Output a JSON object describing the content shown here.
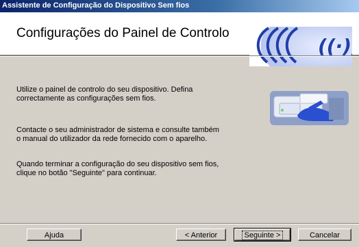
{
  "window": {
    "title": "Assistente de Configuração do Dispositivo Sem fios"
  },
  "header": {
    "title": "Configurações do Painel de Controlo",
    "logo_icon": "wireless-logo-icon"
  },
  "content": {
    "paragraphs": [
      [
        "Utilize o painel de controlo do seu dispositivo. Defina",
        "correctamente as configurações sem fios."
      ],
      [
        "Contacte o seu administrador de sistema e consulte também",
        "o manual do utilizador da rede fornecido com o aparelho."
      ],
      [
        "Quando terminar a configuração do seu dispositivo sem fios,",
        "clique no botão \"Seguinte\" para continuar."
      ]
    ],
    "illustration_icon": "device-control-panel-icon"
  },
  "buttons": {
    "help": "Ajuda",
    "back": "< Anterior",
    "next": "Seguinte >",
    "cancel": "Cancelar"
  },
  "colors": {
    "titlebar": "#0a246a",
    "dialog_bg": "#d4d0c8",
    "logo_blue": "#1f3fa8"
  }
}
